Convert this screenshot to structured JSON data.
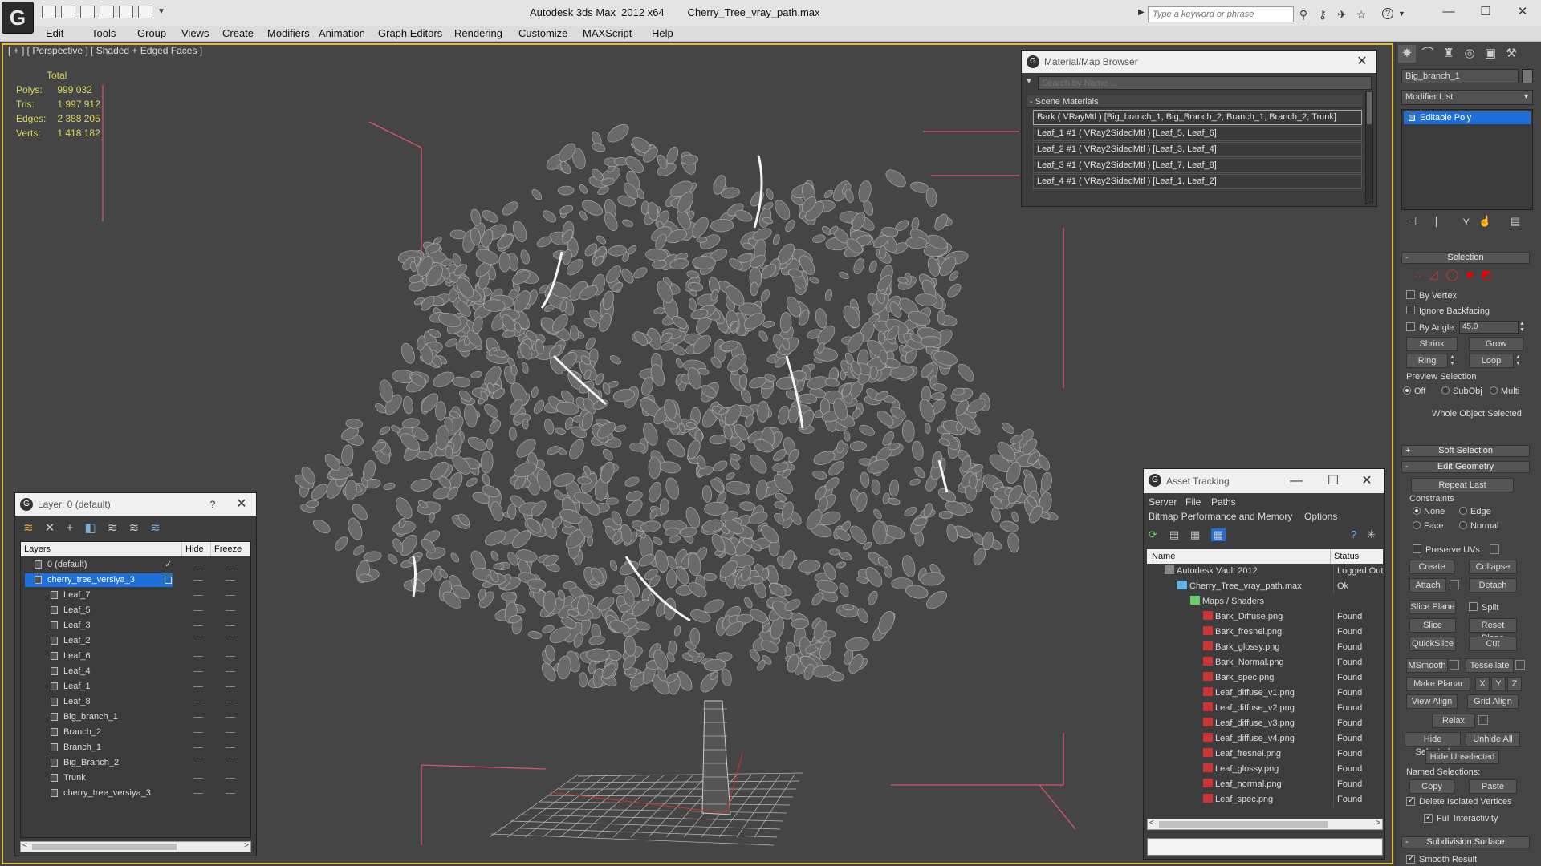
{
  "titlebar": {
    "title": "Autodesk 3ds Max  2012 x64        Cherry_Tree_vray_path.max",
    "search_placeholder": "Type a keyword or phrase"
  },
  "menu": [
    "Edit",
    "Tools",
    "Group",
    "Views",
    "Create",
    "Modifiers",
    "Animation",
    "Graph Editors",
    "Rendering",
    "Customize",
    "MAXScript",
    "Help"
  ],
  "viewport": {
    "label": "[ + ] [ Perspective ] [ Shaded + Edged Faces ]",
    "stats_header": "Total",
    "stats": [
      {
        "label": "Polys:",
        "value": "999 032"
      },
      {
        "label": "Tris:",
        "value": "1 997 912"
      },
      {
        "label": "Edges:",
        "value": "2 388 205"
      },
      {
        "label": "Verts:",
        "value": "1 418 182"
      }
    ]
  },
  "command_panel": {
    "object_name": "Big_branch_1",
    "modifier_list": "Modifier List",
    "stack_item": "Editable Poly",
    "selection": {
      "title": "Selection",
      "by_vertex": "By Vertex",
      "ignore_backfacing": "Ignore Backfacing",
      "by_angle": "By Angle:",
      "angle_value": "45.0",
      "shrink": "Shrink",
      "grow": "Grow",
      "ring": "Ring",
      "loop": "Loop",
      "preview_selection": "Preview Selection",
      "off": "Off",
      "subobj": "SubObj",
      "multi": "Multi",
      "whole_object": "Whole Object Selected"
    },
    "soft_selection": "Soft Selection",
    "edit_geometry": {
      "title": "Edit Geometry",
      "repeat_last": "Repeat Last",
      "constraints": "Constraints",
      "none": "None",
      "edge": "Edge",
      "face": "Face",
      "normal": "Normal",
      "preserve_uvs": "Preserve UVs",
      "create": "Create",
      "collapse": "Collapse",
      "attach": "Attach",
      "detach": "Detach",
      "slice_plane": "Slice Plane",
      "split": "Split",
      "slice": "Slice",
      "reset_plane": "Reset Plane",
      "quickslice": "QuickSlice",
      "cut": "Cut",
      "msmooth": "MSmooth",
      "tessellate": "Tessellate",
      "make_planar": "Make Planar",
      "x": "X",
      "y": "Y",
      "z": "Z",
      "view_align": "View Align",
      "grid_align": "Grid Align",
      "relax": "Relax",
      "hide_selected": "Hide Selected",
      "unhide_all": "Unhide All",
      "hide_unselected": "Hide Unselected",
      "named_selections": "Named Selections:",
      "copy": "Copy",
      "paste": "Paste",
      "delete_isolated": "Delete Isolated Vertices",
      "full_interactivity": "Full Interactivity"
    },
    "subdivision_surface": "Subdivision Surface",
    "smooth_result": "Smooth Result"
  },
  "material_browser": {
    "title": "Material/Map Browser",
    "search_placeholder": "Search by Name ...",
    "group": "Scene Materials",
    "items": [
      "Bark  ( VRayMtl )  [Big_branch_1, Big_Branch_2, Branch_1, Branch_2, Trunk]",
      "Leaf_1 #1  ( VRay2SidedMtl )  [Leaf_5, Leaf_6]",
      "Leaf_2 #1  ( VRay2SidedMtl )  [Leaf_3, Leaf_4]",
      "Leaf_3 #1  ( VRay2SidedMtl )  [Leaf_7, Leaf_8]",
      "Leaf_4 #1  ( VRay2SidedMtl )  [Leaf_1, Leaf_2]"
    ]
  },
  "layer_dialog": {
    "title": "Layer: 0 (default)",
    "help": "?",
    "col_layers": "Layers",
    "col_hide": "Hide",
    "col_freeze": "Freeze",
    "rows": [
      {
        "name": "0 (default)",
        "indent": 0,
        "checked": true
      },
      {
        "name": "cherry_tree_versiya_3",
        "indent": 0,
        "selected": true
      },
      {
        "name": "Leaf_7",
        "indent": 1
      },
      {
        "name": "Leaf_5",
        "indent": 1
      },
      {
        "name": "Leaf_3",
        "indent": 1
      },
      {
        "name": "Leaf_2",
        "indent": 1
      },
      {
        "name": "Leaf_6",
        "indent": 1
      },
      {
        "name": "Leaf_4",
        "indent": 1
      },
      {
        "name": "Leaf_1",
        "indent": 1
      },
      {
        "name": "Leaf_8",
        "indent": 1
      },
      {
        "name": "Big_branch_1",
        "indent": 1
      },
      {
        "name": "Branch_2",
        "indent": 1
      },
      {
        "name": "Branch_1",
        "indent": 1
      },
      {
        "name": "Big_Branch_2",
        "indent": 1
      },
      {
        "name": "Trunk",
        "indent": 1
      },
      {
        "name": "cherry_tree_versiya_3",
        "indent": 1
      }
    ]
  },
  "asset_tracking": {
    "title": "Asset Tracking",
    "menu": [
      "Server",
      "File",
      "Paths"
    ],
    "menu2": [
      "Bitmap Performance and Memory",
      "Options"
    ],
    "col_name": "Name",
    "col_status": "Status",
    "rows": [
      {
        "name": "Autodesk Vault 2012",
        "status": "Logged Out",
        "indent": 0
      },
      {
        "name": "Cherry_Tree_vray_path.max",
        "status": "Ok",
        "indent": 1
      },
      {
        "name": "Maps / Shaders",
        "status": "",
        "indent": 2
      },
      {
        "name": "Bark_Diffuse.png",
        "status": "Found",
        "indent": 3
      },
      {
        "name": "Bark_fresnel.png",
        "status": "Found",
        "indent": 3
      },
      {
        "name": "Bark_glossy.png",
        "status": "Found",
        "indent": 3
      },
      {
        "name": "Bark_Normal.png",
        "status": "Found",
        "indent": 3
      },
      {
        "name": "Bark_spec.png",
        "status": "Found",
        "indent": 3
      },
      {
        "name": "Leaf_diffuse_v1.png",
        "status": "Found",
        "indent": 3
      },
      {
        "name": "Leaf_diffuse_v2.png",
        "status": "Found",
        "indent": 3
      },
      {
        "name": "Leaf_diffuse_v3.png",
        "status": "Found",
        "indent": 3
      },
      {
        "name": "Leaf_diffuse_v4.png",
        "status": "Found",
        "indent": 3
      },
      {
        "name": "Leaf_fresnel.png",
        "status": "Found",
        "indent": 3
      },
      {
        "name": "Leaf_glossy.png",
        "status": "Found",
        "indent": 3
      },
      {
        "name": "Leaf_normal.png",
        "status": "Found",
        "indent": 3
      },
      {
        "name": "Leaf_spec.png",
        "status": "Found",
        "indent": 3
      }
    ]
  },
  "colors": {
    "viewport_border": "#e4bd3d",
    "stats_text": "#d8d860",
    "selection_blue": "#1e6fd9",
    "bounding_box": "#d9546e"
  }
}
